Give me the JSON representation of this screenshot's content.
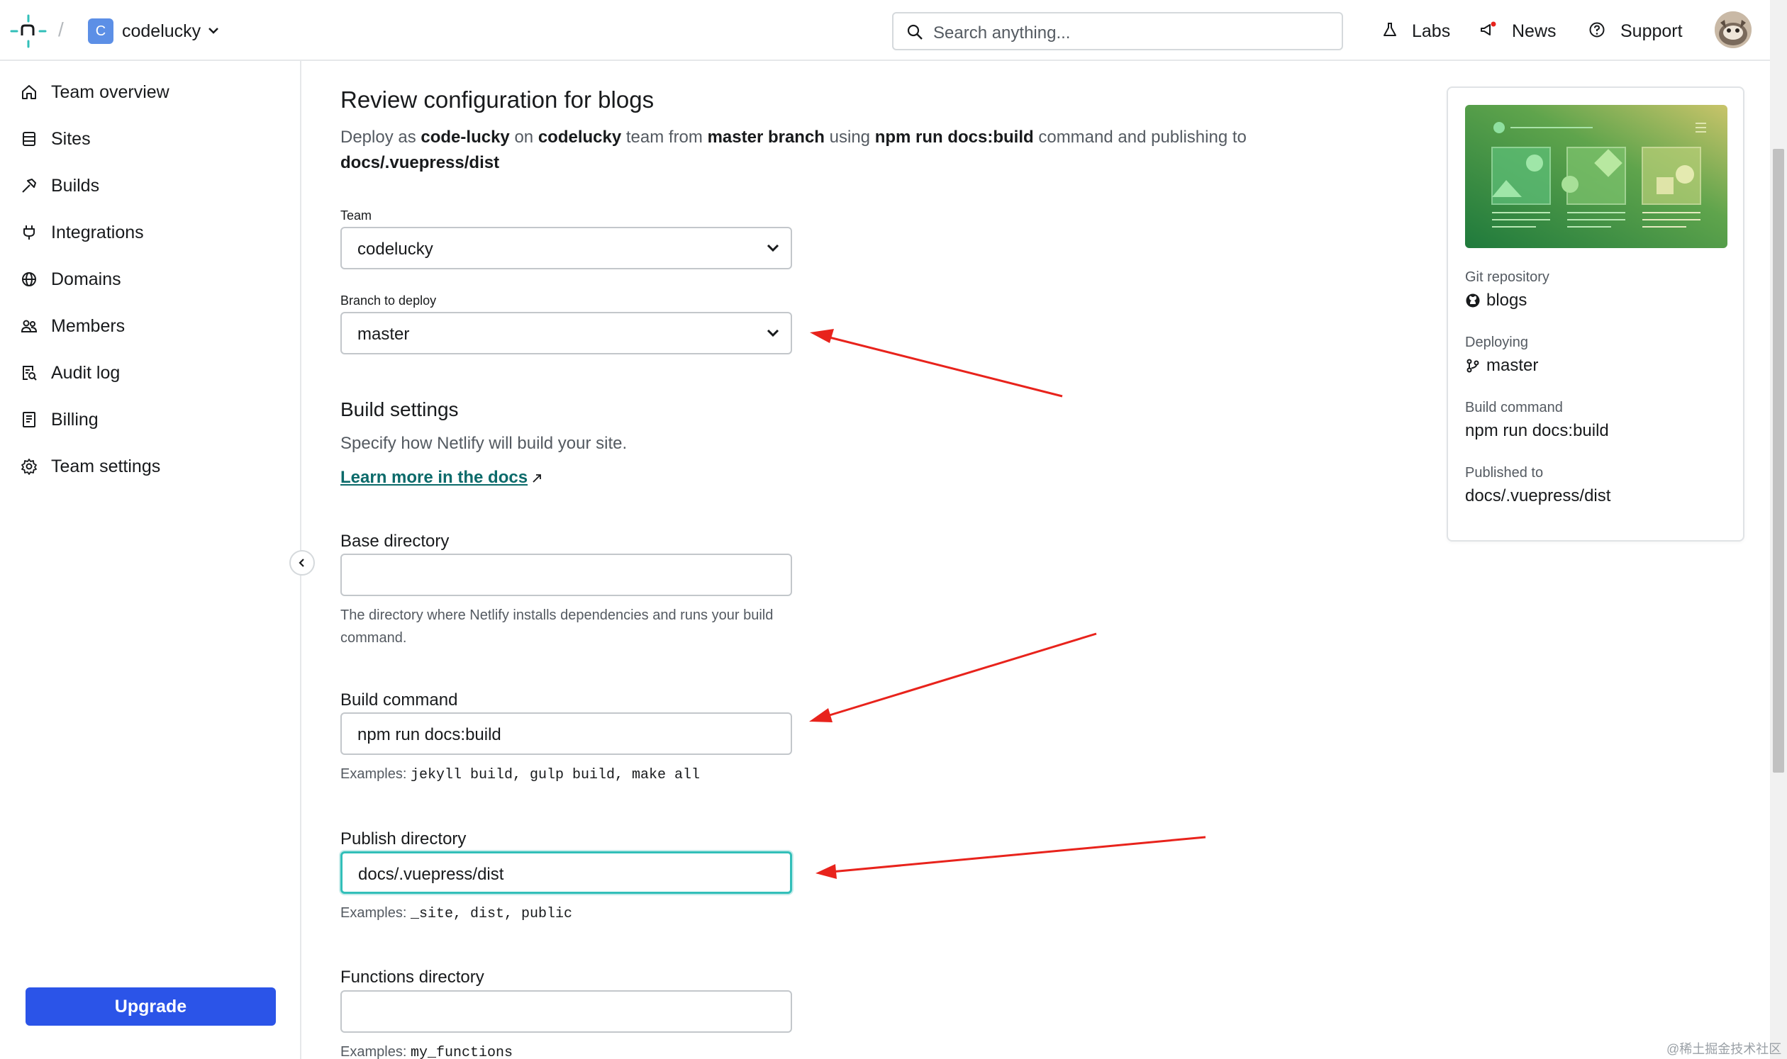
{
  "topbar": {
    "team_initial": "C",
    "team_name": "codelucky",
    "search_placeholder": "Search anything...",
    "links": {
      "labs": "Labs",
      "news": "News",
      "support": "Support"
    }
  },
  "sidebar": {
    "items": [
      {
        "label": "Team overview"
      },
      {
        "label": "Sites"
      },
      {
        "label": "Builds"
      },
      {
        "label": "Integrations"
      },
      {
        "label": "Domains"
      },
      {
        "label": "Members"
      },
      {
        "label": "Audit log"
      },
      {
        "label": "Billing"
      },
      {
        "label": "Team settings"
      }
    ],
    "upgrade_label": "Upgrade"
  },
  "main": {
    "title": "Review configuration for blogs",
    "subtitle": {
      "p1": "Deploy as ",
      "account": "code-lucky",
      "p2": " on ",
      "team": "codelucky",
      "p3": " team from ",
      "branch": "master branch",
      "p4": " using ",
      "command": "npm run docs:build",
      "p5": " command and publishing to ",
      "publish": "docs/.vuepress/dist"
    },
    "team_label": "Team",
    "team_value": "codelucky",
    "branch_label": "Branch to deploy",
    "branch_value": "master",
    "build_settings_title": "Build settings",
    "build_settings_desc": "Specify how Netlify will build your site.",
    "docs_link": "Learn more in the docs",
    "base_dir_label": "Base directory",
    "base_dir_value": "",
    "base_dir_help": "The directory where Netlify installs dependencies and runs your build command.",
    "build_cmd_label": "Build command",
    "build_cmd_value": "npm run docs:build",
    "build_cmd_examples_prefix": "Examples:",
    "build_cmd_examples": "jekyll build, gulp build, make all",
    "publish_dir_label": "Publish directory",
    "publish_dir_value": "docs/.vuepress/dist",
    "publish_dir_examples_prefix": "Examples:",
    "publish_dir_examples": "_site, dist, public",
    "functions_dir_label": "Functions directory",
    "functions_dir_value": "",
    "functions_dir_examples_prefix": "Examples:",
    "functions_dir_examples": "my_functions"
  },
  "card": {
    "git_repo_label": "Git repository",
    "git_repo_value": "blogs",
    "deploying_label": "Deploying",
    "deploying_value": "master",
    "build_cmd_label": "Build command",
    "build_cmd_value": "npm run docs:build",
    "published_label": "Published to",
    "published_value": "docs/.vuepress/dist"
  },
  "watermark": "@稀土掘金技术社区",
  "colors": {
    "accent_teal": "#32bfb9",
    "upgrade_blue": "#2b54e8",
    "annotation_red": "#e8231c",
    "link_teal": "#0b6a6a"
  }
}
